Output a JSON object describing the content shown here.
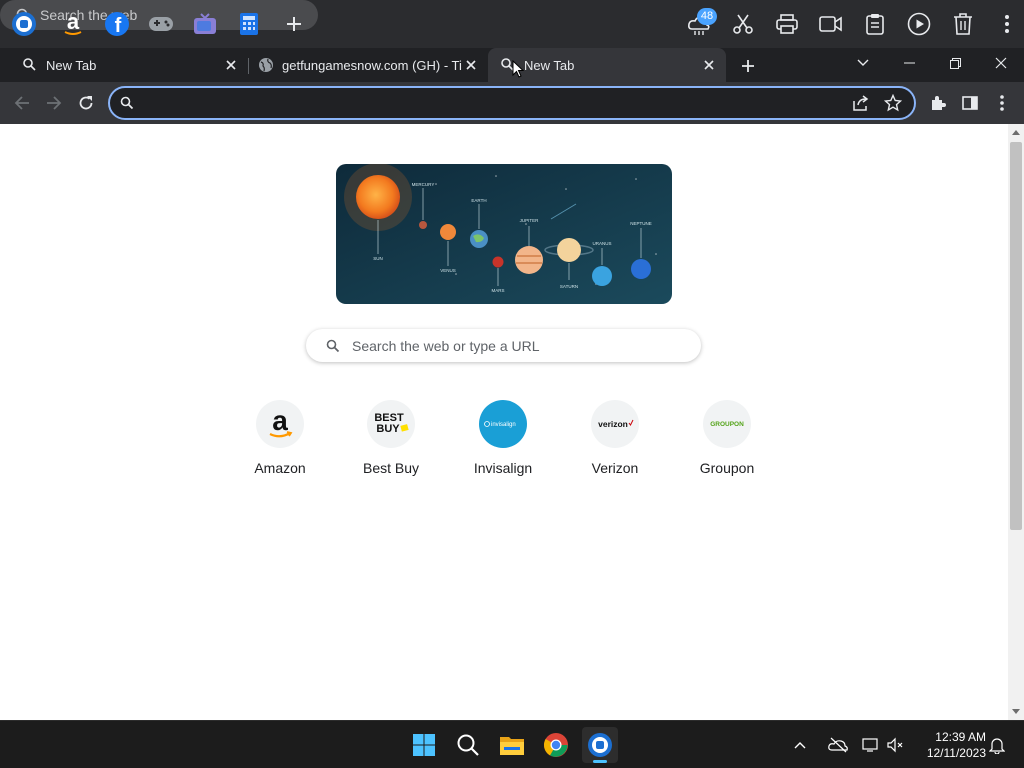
{
  "toolbar": {
    "search_placeholder": "Search the web",
    "weather_badge": "48"
  },
  "tabs": [
    {
      "title": "New Tab",
      "icon": "search-icon",
      "active": false
    },
    {
      "title": "getfungamesnow.com (GH) - Tic",
      "icon": "globe-icon",
      "active": false
    },
    {
      "title": "New Tab",
      "icon": "search-icon",
      "active": true
    }
  ],
  "omnibox": {
    "value": ""
  },
  "page": {
    "search_placeholder": "Search the web or type a URL",
    "doodle_labels": {
      "sun": "SUN",
      "mercury": "MERCURY",
      "venus": "VENUS",
      "earth": "EARTH",
      "mars": "MARS",
      "jupiter": "JUPITER",
      "saturn": "SATURN",
      "uranus": "URANUS",
      "neptune": "NEPTUNE"
    },
    "shortcuts": [
      {
        "label": "Amazon",
        "logo_text": "a"
      },
      {
        "label": "Best Buy",
        "logo_text": "BEST BUY"
      },
      {
        "label": "Invisalign",
        "logo_text": "invisalign"
      },
      {
        "label": "Verizon",
        "logo_text": "verizon"
      },
      {
        "label": "Groupon",
        "logo_text": "GROUPON"
      }
    ]
  },
  "taskbar": {
    "time": "12:39 AM",
    "date": "12/11/2023"
  },
  "colors": {
    "accent": "#8ab4f8",
    "tab_active": "#35363a",
    "toolbar": "#2b2c2f",
    "invisalign": "#1a9fd6",
    "groupon": "#53a318"
  }
}
